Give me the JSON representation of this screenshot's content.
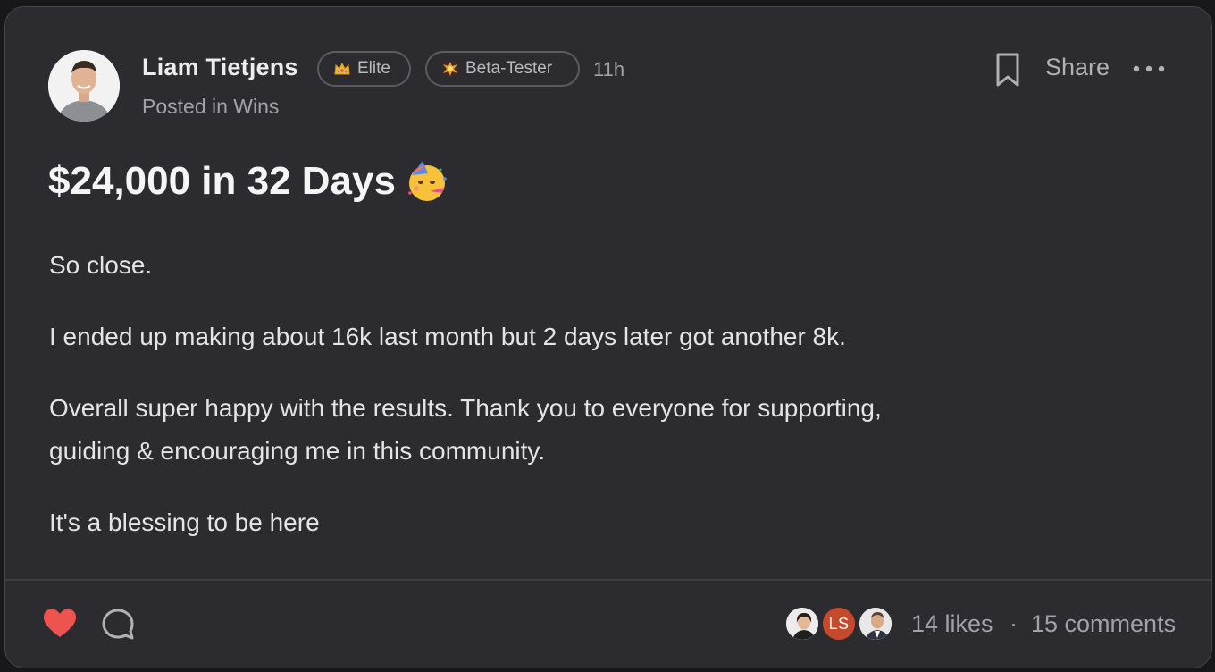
{
  "post": {
    "author": {
      "name": "Liam Tietjens",
      "avatar": "avatar-photo"
    },
    "badges": [
      {
        "icon": "crown-icon",
        "label": "Elite"
      },
      {
        "icon": "explosion-icon",
        "label": "Beta-Tester"
      }
    ],
    "time": "11h",
    "posted_in_prefix": "Posted in ",
    "category": "Wins",
    "title": "$24,000 in 32 Days",
    "title_emoji": "partying-face-emoji",
    "paragraphs": [
      "So close.",
      "I ended up making about 16k last month but 2 days later got another 8k.",
      "Overall super happy with the results. Thank you to everyone for supporting,",
      "guiding & encouraging me in this community.",
      "It's a blessing to be here"
    ],
    "actions": {
      "share_label": "Share",
      "bookmark_icon": "bookmark-icon",
      "more_icon": "more-icon"
    }
  },
  "footer": {
    "liked_avatars": [
      {
        "type": "photo",
        "initials": ""
      },
      {
        "type": "initials",
        "initials": "LS"
      },
      {
        "type": "photo",
        "initials": ""
      }
    ],
    "likes_text": "14 likes",
    "separator": "·",
    "comments_text": "15 comments"
  },
  "colors": {
    "card_background": "#2b2b30",
    "heart": "#ef5350",
    "initials_avatar": "#c5492b"
  }
}
